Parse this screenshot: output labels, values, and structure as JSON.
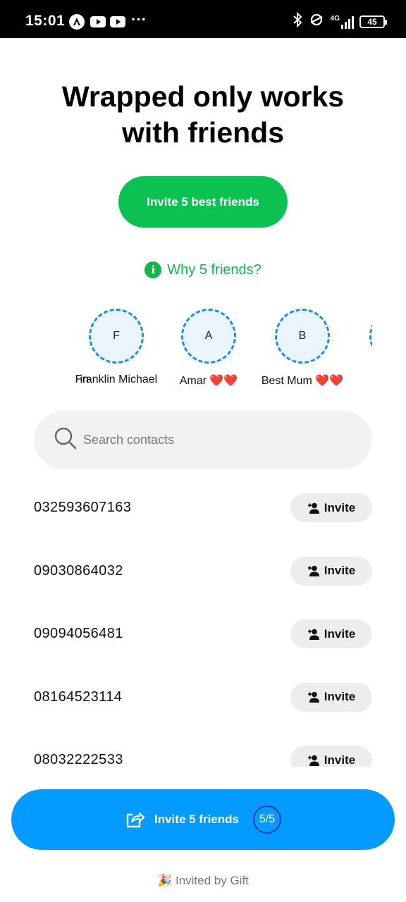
{
  "status_bar": {
    "time": "15:01",
    "network": "4G",
    "battery": "45",
    "icons": [
      "circle-a-icon",
      "youtube-icon",
      "youtube-icon",
      "more-dots-icon",
      "bluetooth-icon",
      "hotspot-icon",
      "signal-icon",
      "battery-icon"
    ]
  },
  "headline": {
    "line1": "Wrapped only works",
    "line2": "with friends"
  },
  "invite_best_button": "Invite 5 best friends",
  "why_link": {
    "icon_text": "i",
    "label": "Why 5 friends?"
  },
  "friends": [
    {
      "initial": "",
      "name": "in"
    },
    {
      "initial": "F",
      "name": "Franklin Michael"
    },
    {
      "initial": "A",
      "name": "Amar ❤️❤️"
    },
    {
      "initial": "B",
      "name": "Best Mum ❤️❤️"
    },
    {
      "initial": "",
      "name": ""
    }
  ],
  "search": {
    "placeholder": "Search contacts"
  },
  "contacts": [
    {
      "phone": "032593607163",
      "action": "Invite"
    },
    {
      "phone": "09030864032",
      "action": "Invite"
    },
    {
      "phone": "09094056481",
      "action": "Invite"
    },
    {
      "phone": "08164523114",
      "action": "Invite"
    },
    {
      "phone": "08032222533",
      "action": "Invite"
    }
  ],
  "bottom_button": {
    "label": "Invite 5 friends",
    "counter": "5/5"
  },
  "footer": "🎉 Invited by Gift",
  "colors": {
    "green": "#0ac151",
    "blue": "#039bff",
    "dash_blue": "#1e8fd8"
  }
}
